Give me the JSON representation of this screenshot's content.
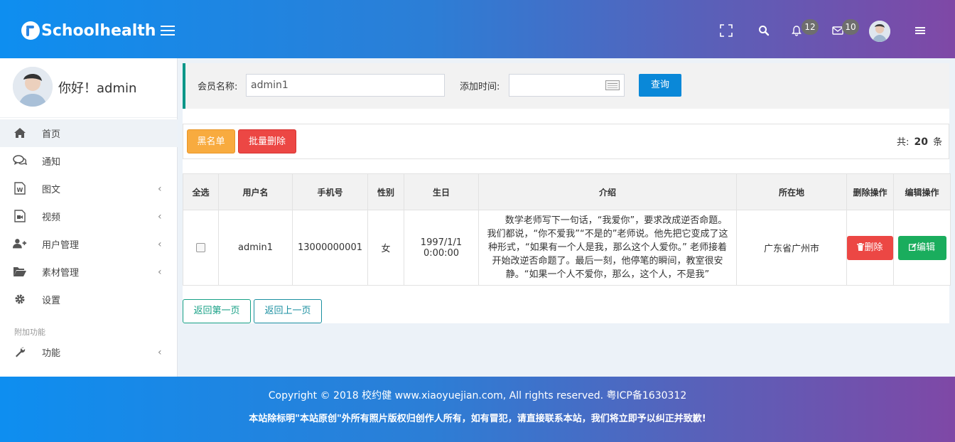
{
  "header": {
    "logo_text": "Schoolhealth",
    "notif_count": "12",
    "mail_count": "10"
  },
  "sidebar": {
    "greeting": "你好！admin",
    "items": [
      {
        "label": "首页",
        "icon": "home-icon"
      },
      {
        "label": "通知",
        "icon": "comments-icon"
      },
      {
        "label": "图文",
        "icon": "word-file-icon"
      },
      {
        "label": "视频",
        "icon": "video-file-icon"
      },
      {
        "label": "用户管理",
        "icon": "user-plus-icon"
      },
      {
        "label": "素材管理",
        "icon": "folder-open-icon"
      },
      {
        "label": "设置",
        "icon": "gear-icon"
      }
    ],
    "section_label": "附加功能",
    "extra_items": [
      {
        "label": "功能",
        "icon": "wrench-icon"
      }
    ]
  },
  "search": {
    "member_label": "会员名称:",
    "member_value": "admin1",
    "time_label": "添加时间:",
    "time_value": "",
    "query_button": "查询"
  },
  "toolbar": {
    "blacklist_button": "黑名单",
    "batch_delete_button": "批量删除",
    "total_prefix": "共:",
    "total_count": "20",
    "total_suffix": "条"
  },
  "table": {
    "headers": [
      "全选",
      "用户名",
      "手机号",
      "性别",
      "生日",
      "介绍",
      "所在地",
      "删除操作",
      "编辑操作"
    ],
    "rows": [
      {
        "username": "admin1",
        "phone": "13000000001",
        "gender": "女",
        "birthday": "1997/1/1 0:00:00",
        "intro": "数学老师写下一句话，“我爱你”，要求改成逆否命题。我们都说，“你不爱我”“不是的”老师说。他先把它变成了这种形式，“如果有一个人是我，那么这个人爱你。” 老师接着开始改逆否命题了。最后一刻，他停笔的瞬间，教室很安静。“如果一个人不爱你，那么，这个人，不是我”",
        "location": "广东省广州市",
        "delete_label": "删除",
        "edit_label": "编辑"
      }
    ]
  },
  "pager": {
    "first_label": "返回第一页",
    "prev_label": "返回上一页"
  },
  "footer": {
    "copyright": "Copyright © 2018 校约健 www.xiaoyuejian.com, All rights reserved. 粤ICP备1630312",
    "notice": "本站除标明\"本站原创\"外所有照片版权归创作人所有，如有冒犯，请直接联系本站，我们将立即予以纠正并致歉!"
  }
}
